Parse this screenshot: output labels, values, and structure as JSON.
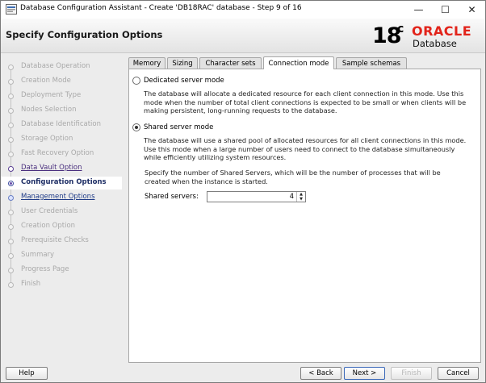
{
  "window": {
    "title": "Database Configuration Assistant - Create 'DB18RAC' database - Step 9 of 16",
    "min_glyph": "—",
    "max_glyph": "☐",
    "close_glyph": "✕"
  },
  "header": {
    "page_title": "Specify Configuration Options",
    "version": "18",
    "version_sup": "c",
    "brand": "ORACLE",
    "product": "Database",
    "brand_color": "#e2231a"
  },
  "steps": [
    {
      "label": "Database Operation",
      "state": "done"
    },
    {
      "label": "Creation Mode",
      "state": "done"
    },
    {
      "label": "Deployment Type",
      "state": "done"
    },
    {
      "label": "Nodes Selection",
      "state": "done"
    },
    {
      "label": "Database Identification",
      "state": "done"
    },
    {
      "label": "Storage Option",
      "state": "done"
    },
    {
      "label": "Fast Recovery Option",
      "state": "done"
    },
    {
      "label": "Data Vault Option",
      "state": "visited"
    },
    {
      "label": "Configuration Options",
      "state": "current"
    },
    {
      "label": "Management Options",
      "state": "next"
    },
    {
      "label": "User Credentials",
      "state": "pending"
    },
    {
      "label": "Creation Option",
      "state": "pending"
    },
    {
      "label": "Prerequisite Checks",
      "state": "pending"
    },
    {
      "label": "Summary",
      "state": "pending"
    },
    {
      "label": "Progress Page",
      "state": "pending"
    },
    {
      "label": "Finish",
      "state": "pending"
    }
  ],
  "tabs": [
    {
      "label": "Memory"
    },
    {
      "label": "Sizing"
    },
    {
      "label": "Character sets"
    },
    {
      "label": "Connection mode",
      "active": true
    },
    {
      "label": "Sample schemas"
    }
  ],
  "connection": {
    "dedicated_label": "Dedicated server mode",
    "dedicated_selected": false,
    "dedicated_desc": "The database will allocate a dedicated resource for each client connection in this mode. Use this mode when the number of total client connections is expected to be small or when clients will be making persistent, long-running requests to the database.",
    "shared_label": "Shared server mode",
    "shared_selected": true,
    "shared_desc": "The database will use a shared pool of allocated resources for all client connections in this mode.  Use this mode when a large number of users need to connect to the database simultaneously while efficiently utilizing system resources.",
    "shared_servers_note": "Specify the number of Shared Servers, which will be the number of processes that will be created when the instance is started.",
    "shared_servers_label": "Shared servers:",
    "shared_servers_value": "4"
  },
  "buttons": {
    "help": "Help",
    "back": "< Back",
    "next": "Next >",
    "finish": "Finish",
    "cancel": "Cancel"
  }
}
